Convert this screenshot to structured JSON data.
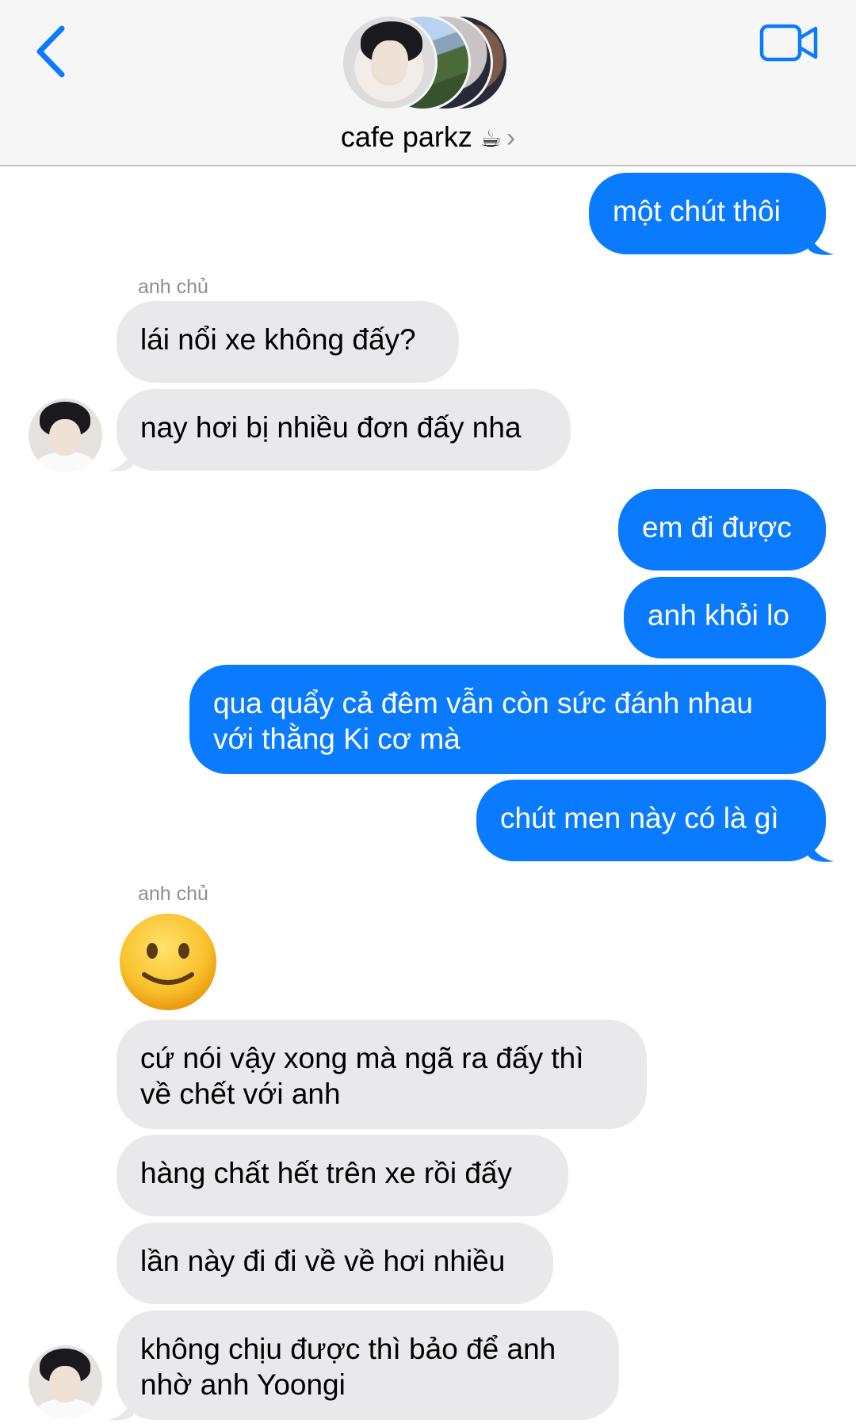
{
  "header": {
    "title": "cafe parkz",
    "title_emoji": "☕",
    "chevron": "›"
  },
  "colors": {
    "outgoing_bubble": "#0a7bff",
    "incoming_bubble": "#e9e9eb",
    "accent": "#0a7bff",
    "header_bg": "#f6f6f7"
  },
  "messages": {
    "m1": "một chút thôi",
    "sender1": "anh chủ",
    "m2": "lái nổi xe không đấy?",
    "m3": "nay hơi bị nhiều đơn đấy nha",
    "m4": "em đi được",
    "m5": "anh khỏi lo",
    "m6a": "qua quẩy cả đêm vẫn còn sức đánh nhau",
    "m6b": "với thằng Ki cơ mà",
    "m7": "chút men này có là gì",
    "sender2": "anh chủ",
    "emoji_name": "slightly-smiling-face",
    "m8a": "cứ nói vậy xong mà ngã ra đấy thì",
    "m8b": "về chết với anh",
    "m9": "hàng chất hết trên xe rồi đấy",
    "m10": "lần này đi đi về về hơi nhiều",
    "m11a": "không chịu được thì bảo để anh",
    "m11b": "nhờ anh Yoongi"
  }
}
